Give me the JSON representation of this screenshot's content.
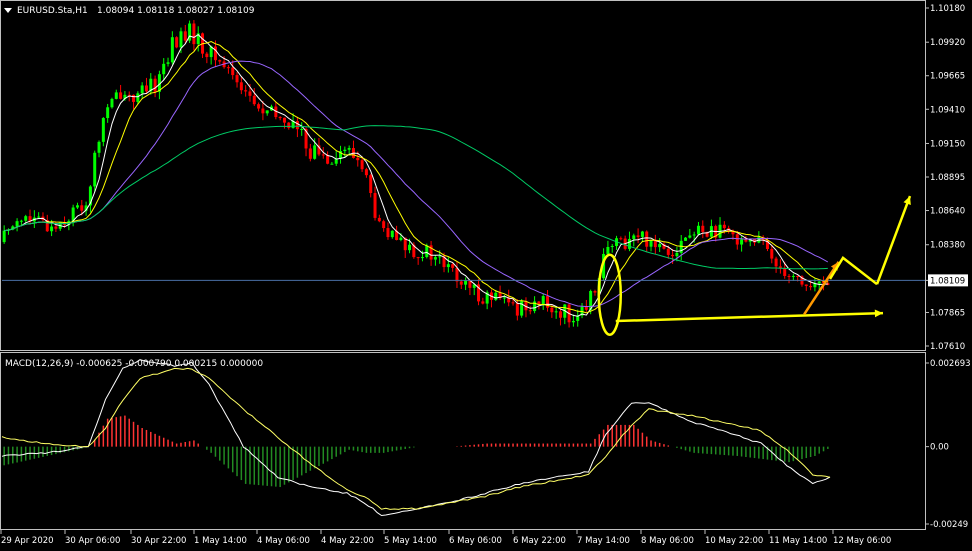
{
  "header": {
    "symbol": "EURUSD.Sta,H1",
    "ohlc": "1.08094 1.08118 1.08027 1.08109"
  },
  "macd_header": "MACD(12,26,9) -0.000625 -0.000790 0.000215 0.000000",
  "colors": {
    "background": "#000000",
    "bull": "#00ff00",
    "bear": "#ff0000",
    "grid_text": "#ffffff",
    "frame": "#c0c0c0",
    "ma_fast": "#ffffff",
    "ma_mid": "#ffff00",
    "ma_slow": "#9966ff",
    "ma_long": "#00cc66",
    "annotation": "#ffff00",
    "price_line": "#4a6fa5",
    "macd_hist_pos": "#ff3333",
    "macd_hist_neg": "#228b22",
    "macd_line": "#ffffff",
    "signal_line": "#ffff66"
  },
  "chart_data": [
    {
      "type": "candlestick",
      "title": "EURUSD.Sta,H1",
      "ylim": [
        1.0761,
        1.1018
      ],
      "y_ticks": [
        "1.10180",
        "1.09920",
        "1.09665",
        "1.09410",
        "1.09150",
        "1.08895",
        "1.08640",
        "1.08380",
        "1.08109",
        "1.07865",
        "1.07610"
      ],
      "current_price": "1.08109",
      "x_ticks": [
        "29 Apr 2020",
        "30 Apr 06:00",
        "30 Apr 22:00",
        "1 May 14:00",
        "4 May 06:00",
        "4 May 22:00",
        "5 May 14:00",
        "6 May 06:00",
        "6 May 22:00",
        "7 May 14:00",
        "8 May 06:00",
        "10 May 22:00",
        "11 May 14:00",
        "12 May 06:00"
      ],
      "close_path": [
        [
          0,
          1.084
        ],
        [
          4,
          1.086
        ],
        [
          8,
          1.0855
        ],
        [
          12,
          1.0852
        ],
        [
          16,
          1.086
        ],
        [
          20,
          1.087
        ],
        [
          24,
          1.0935
        ],
        [
          28,
          1.0955
        ],
        [
          32,
          1.095
        ],
        [
          36,
          1.096
        ],
        [
          40,
          1.099
        ],
        [
          44,
          1.1
        ],
        [
          48,
          1.0985
        ],
        [
          52,
          1.0975
        ],
        [
          56,
          1.096
        ],
        [
          60,
          1.094
        ],
        [
          64,
          1.0935
        ],
        [
          68,
          1.093
        ],
        [
          72,
          1.091
        ],
        [
          76,
          1.0905
        ],
        [
          80,
          1.091
        ],
        [
          84,
          1.09
        ],
        [
          88,
          1.085
        ],
        [
          92,
          1.084
        ],
        [
          96,
          1.0835
        ],
        [
          100,
          1.083
        ],
        [
          104,
          1.082
        ],
        [
          108,
          1.0805
        ],
        [
          112,
          1.08
        ],
        [
          116,
          1.0795
        ],
        [
          120,
          1.079
        ],
        [
          124,
          1.0795
        ],
        [
          128,
          1.079
        ],
        [
          132,
          1.0785
        ],
        [
          136,
          1.0785
        ],
        [
          140,
          1.083
        ],
        [
          144,
          1.084
        ],
        [
          148,
          1.0845
        ],
        [
          152,
          1.084
        ],
        [
          156,
          1.0835
        ],
        [
          160,
          1.0845
        ],
        [
          164,
          1.085
        ],
        [
          168,
          1.0845
        ],
        [
          172,
          1.0845
        ],
        [
          176,
          1.084
        ],
        [
          180,
          1.0825
        ],
        [
          184,
          1.0815
        ],
        [
          188,
          1.0805
        ],
        [
          192,
          1.081
        ]
      ],
      "candle_count": 192,
      "moving_averages": [
        {
          "period": 5,
          "color": "#ffffff"
        },
        {
          "period": 10,
          "color": "#ffff00"
        },
        {
          "period": 24,
          "color": "#9966ff"
        },
        {
          "period": 80,
          "color": "#00cc66"
        }
      ]
    },
    {
      "type": "macd",
      "title": "MACD(12,26,9)",
      "values": "-0.000625 -0.000790 0.000215 0.000000",
      "ylim": [
        -0.00249,
        0.002693
      ],
      "y_ticks": [
        "0.002693",
        "0.00",
        "-0.00249"
      ],
      "macd_path": [
        [
          0,
          -0.0003
        ],
        [
          10,
          -0.0002
        ],
        [
          20,
          0.0
        ],
        [
          24,
          0.0015
        ],
        [
          28,
          0.0025
        ],
        [
          32,
          0.0028
        ],
        [
          40,
          0.0026
        ],
        [
          44,
          0.0027
        ],
        [
          48,
          0.002
        ],
        [
          56,
          0.0
        ],
        [
          64,
          -0.001
        ],
        [
          72,
          -0.0013
        ],
        [
          80,
          -0.0015
        ],
        [
          84,
          -0.0018
        ],
        [
          88,
          -0.0022
        ],
        [
          96,
          -0.002
        ],
        [
          104,
          -0.0018
        ],
        [
          112,
          -0.0015
        ],
        [
          120,
          -0.0012
        ],
        [
          128,
          -0.001
        ],
        [
          136,
          -0.0008
        ],
        [
          140,
          0.0004
        ],
        [
          146,
          0.0014
        ],
        [
          150,
          0.0014
        ],
        [
          160,
          0.0008
        ],
        [
          170,
          0.0004
        ],
        [
          176,
          0.0001
        ],
        [
          182,
          -0.0006
        ],
        [
          188,
          -0.0012
        ],
        [
          192,
          -0.001
        ]
      ],
      "signal_path": [
        [
          0,
          0.0003
        ],
        [
          10,
          0.0001
        ],
        [
          20,
          0.0
        ],
        [
          24,
          0.0006
        ],
        [
          28,
          0.0015
        ],
        [
          32,
          0.0022
        ],
        [
          40,
          0.0025
        ],
        [
          44,
          0.0025
        ],
        [
          48,
          0.0022
        ],
        [
          56,
          0.0012
        ],
        [
          64,
          0.0003
        ],
        [
          72,
          -0.0006
        ],
        [
          80,
          -0.0014
        ],
        [
          84,
          -0.0016
        ],
        [
          88,
          -0.002
        ],
        [
          96,
          -0.002
        ],
        [
          104,
          -0.0018
        ],
        [
          112,
          -0.0016
        ],
        [
          120,
          -0.0013
        ],
        [
          128,
          -0.0011
        ],
        [
          136,
          -0.0009
        ],
        [
          140,
          -0.0003
        ],
        [
          146,
          0.0007
        ],
        [
          150,
          0.0012
        ],
        [
          160,
          0.001
        ],
        [
          170,
          0.0007
        ],
        [
          176,
          0.0005
        ],
        [
          182,
          -0.0001
        ],
        [
          188,
          -0.0009
        ],
        [
          192,
          -0.001
        ]
      ]
    }
  ]
}
